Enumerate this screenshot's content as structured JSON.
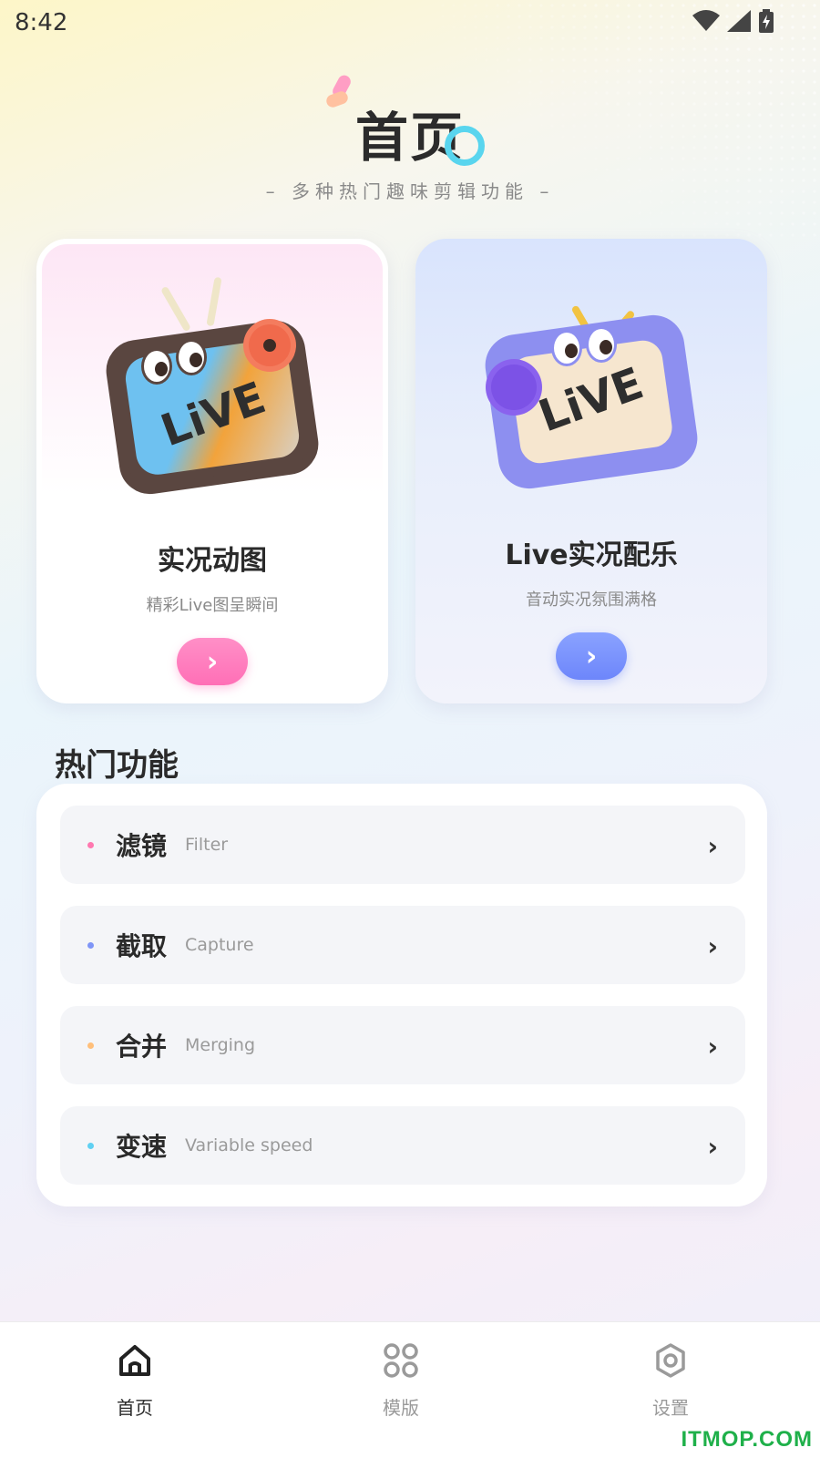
{
  "status_bar": {
    "time": "8:42"
  },
  "header": {
    "title": "首页",
    "subtitle": "– 多种热门趣味剪辑功能 –"
  },
  "cards": [
    {
      "title": "实况动图",
      "subtitle": "精彩Live图呈瞬间",
      "button_icon": "chevron-right-icon",
      "accent": "#ff74b9",
      "illustration_text": "LiVE"
    },
    {
      "title": "Live实况配乐",
      "subtitle": "音动实况氛围满格",
      "button_icon": "chevron-right-icon",
      "accent": "#7189fb",
      "illustration_text": "LiVE"
    }
  ],
  "hot": {
    "title": "热门功能",
    "items": [
      {
        "zh": "滤镜",
        "en": "Filter",
        "dot_color": "#ff78b0"
      },
      {
        "zh": "截取",
        "en": "Capture",
        "dot_color": "#7f95f7"
      },
      {
        "zh": "合并",
        "en": "Merging",
        "dot_color": "#ffbf7a"
      },
      {
        "zh": "变速",
        "en": "Variable speed",
        "dot_color": "#5fd0f2"
      }
    ]
  },
  "nav": {
    "items": [
      {
        "label": "首页",
        "icon": "home-icon",
        "active": true
      },
      {
        "label": "模版",
        "icon": "template-grid-icon",
        "active": false
      },
      {
        "label": "设置",
        "icon": "settings-gear-icon",
        "active": false
      }
    ]
  },
  "watermark": "ITMOP.COM",
  "chevron": "›"
}
